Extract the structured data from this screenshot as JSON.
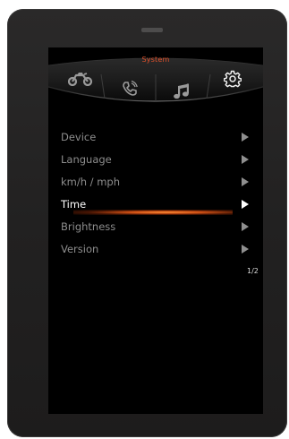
{
  "screen": {
    "title": "System"
  },
  "tabs": [
    {
      "icon": "motorcycle-icon",
      "selected": false
    },
    {
      "icon": "phone-icon",
      "selected": false
    },
    {
      "icon": "music-note-icon",
      "selected": false
    },
    {
      "icon": "gear-icon",
      "selected": true
    }
  ],
  "menu": {
    "items": [
      {
        "label": "Device",
        "selected": false
      },
      {
        "label": "Language",
        "selected": false
      },
      {
        "label": "km/h / mph",
        "selected": false
      },
      {
        "label": "Time",
        "selected": true
      },
      {
        "label": "Brightness",
        "selected": false
      },
      {
        "label": "Version",
        "selected": false
      }
    ]
  },
  "pagination": {
    "indicator": "1/2"
  },
  "colors": {
    "accent": "#e0502a",
    "selected_text": "#ffffff",
    "unselected_text": "#8d8d8d",
    "screen_background": "#000000"
  }
}
